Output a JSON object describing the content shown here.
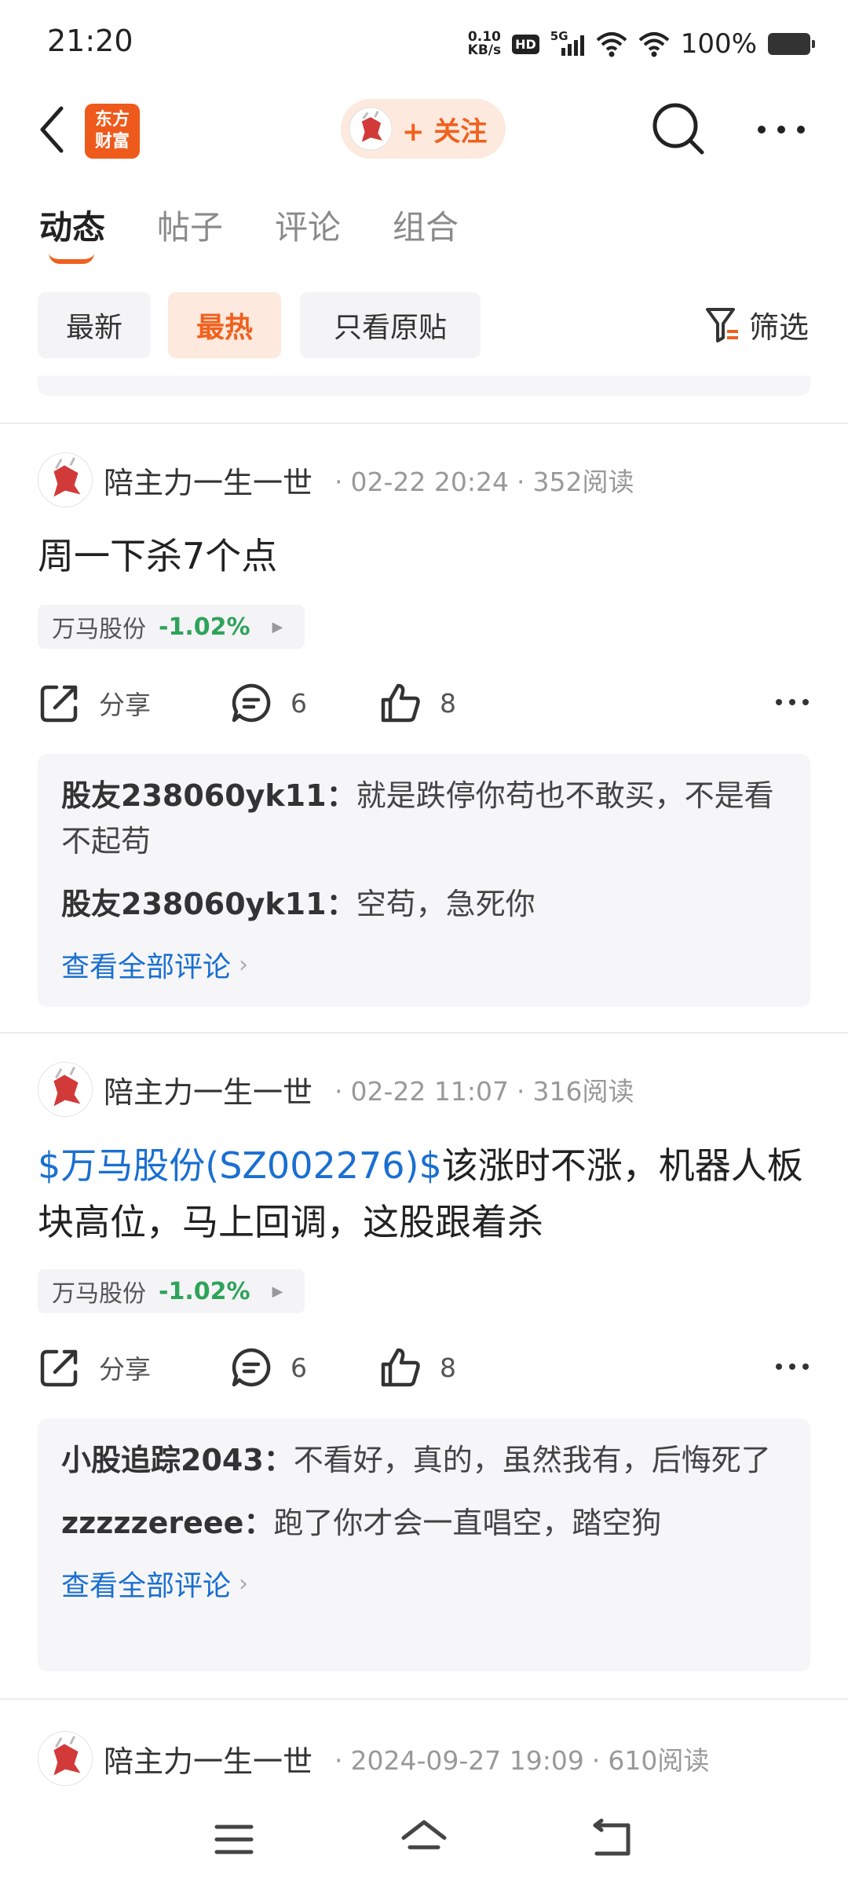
{
  "status": {
    "time": "21:20",
    "net_speed_value": "0.10",
    "net_speed_unit": "KB/s",
    "hd_label": "HD",
    "network_label": "5G",
    "battery_pct": "100%"
  },
  "header": {
    "app_logo_line1": "东方",
    "app_logo_line2": "财富",
    "follow_label": "+ 关注"
  },
  "tabs": [
    {
      "label": "动态"
    },
    {
      "label": "帖子"
    },
    {
      "label": "评论"
    },
    {
      "label": "组合"
    }
  ],
  "filters": {
    "chips": [
      {
        "label": "最新"
      },
      {
        "label": "最热"
      },
      {
        "label": "只看原贴"
      }
    ],
    "filter_label": "筛选"
  },
  "posts": [
    {
      "author": "陪主力一生一世",
      "time": "02-22 20:24",
      "reads": "352阅读",
      "link_text": "",
      "text": "周一下杀7个点",
      "stock_name": "万马股份",
      "stock_change": "-1.02%",
      "share_label": "分享",
      "comment_count": "6",
      "like_count": "8",
      "comments": [
        {
          "user": "股友238060yk11：",
          "text": "就是跌停你苟也不敢买，不是看不起苟"
        },
        {
          "user": "股友238060yk11：",
          "text": "空苟，急死你"
        }
      ],
      "view_all": "查看全部评论"
    },
    {
      "author": "陪主力一生一世",
      "time": "02-22 11:07",
      "reads": "316阅读",
      "link_text": "$万马股份(SZ002276)$",
      "text": "该涨时不涨，机器人板块高位，马上回调，这股跟着杀",
      "stock_name": "万马股份",
      "stock_change": "-1.02%",
      "share_label": "分享",
      "comment_count": "6",
      "like_count": "8",
      "comments": [
        {
          "user": "小股追踪2043：",
          "text": "不看好，真的，虽然我有，后悔死了"
        },
        {
          "user": "zzzzzereee：",
          "text": "跑了你才会一直唱空，踏空狗"
        }
      ],
      "view_all": "查看全部评论"
    },
    {
      "author": "陪主力一生一世",
      "time": "2024-09-27 19:09",
      "reads": "610阅读"
    }
  ],
  "colors": {
    "accent": "#f0601e",
    "link": "#1a6fd1",
    "down_green": "#2ea35a",
    "chip_bg": "#f4f4f6"
  }
}
